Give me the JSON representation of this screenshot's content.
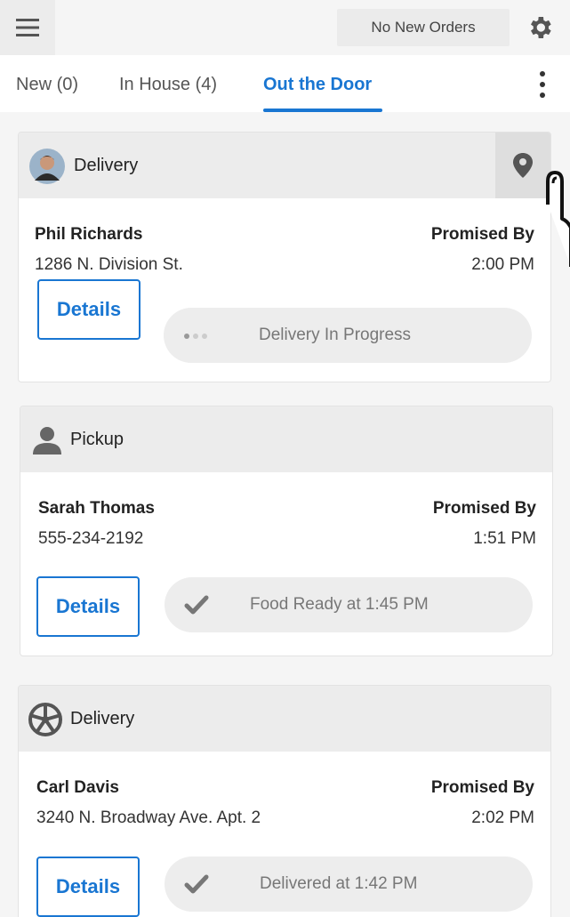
{
  "header": {
    "orders_status": "No New Orders"
  },
  "tabs": [
    {
      "label": "New (0)",
      "active": false
    },
    {
      "label": "In House (4)",
      "active": false
    },
    {
      "label": "Out the Door",
      "active": true
    }
  ],
  "colors": {
    "accent": "#1976d2",
    "header_bg": "#ececec"
  },
  "orders": [
    {
      "type": "Delivery",
      "icon": "driver-avatar",
      "customer": "Phil Richards",
      "detail": "1286 N. Division St.",
      "promised_label": "Promised By",
      "promised_time": "2:00 PM",
      "details_label": "Details",
      "status_icon": "progress-dots-icon",
      "status": "Delivery In Progress"
    },
    {
      "type": "Pickup",
      "icon": "person-icon",
      "customer": "Sarah Thomas",
      "detail": "555-234-2192",
      "promised_label": "Promised By",
      "promised_time": "1:51 PM",
      "details_label": "Details",
      "status_icon": "checkmark-icon",
      "status": "Food Ready at 1:45 PM"
    },
    {
      "type": "Delivery",
      "icon": "wheel-icon",
      "customer": "Carl Davis",
      "detail": "3240 N. Broadway Ave. Apt. 2",
      "promised_label": "Promised By",
      "promised_time": "2:02 PM",
      "details_label": "Details",
      "status_icon": "checkmark-icon",
      "status": "Delivered at 1:42 PM"
    }
  ]
}
